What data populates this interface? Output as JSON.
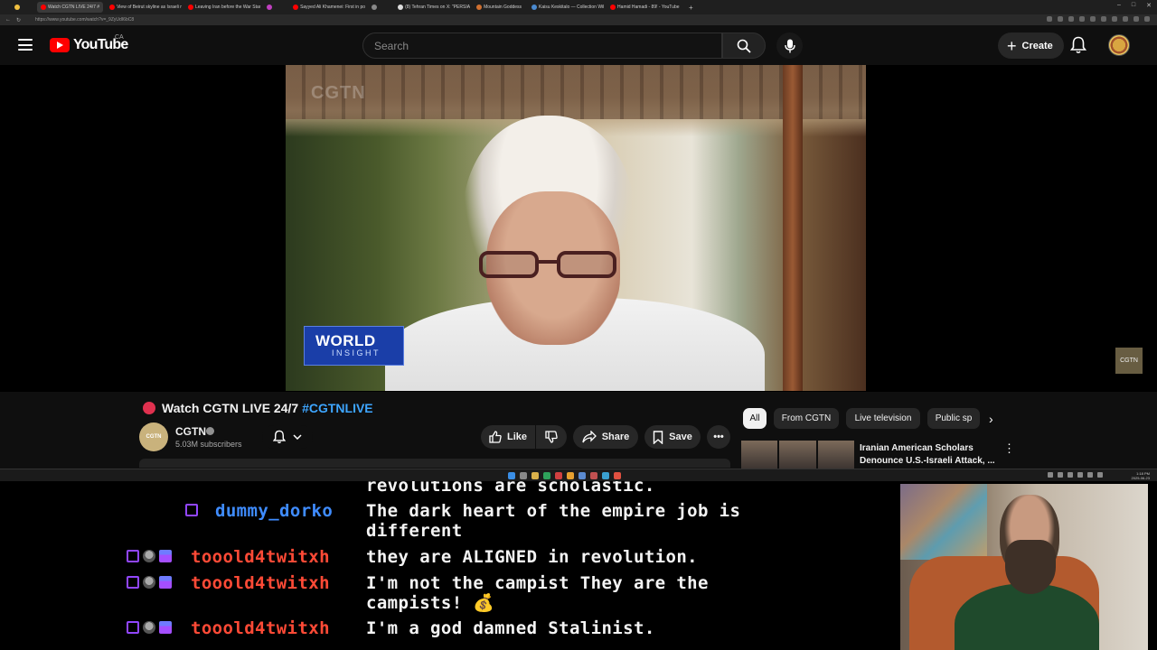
{
  "browser": {
    "tabs": [
      {
        "label": "",
        "color": "#f0c040"
      },
      {
        "label": "Watch CGTN LIVE 24/7 #",
        "color": "#ff0000",
        "active": true
      },
      {
        "label": "View of Beirut skyline as Israeli m",
        "color": "#ff0000"
      },
      {
        "label": "Leaving Iran before the War Starts",
        "color": "#ff0000"
      },
      {
        "label": "",
        "color": "#c040c0"
      },
      {
        "label": "Sayyed Ali Khamenei: First in pov",
        "color": "#ff0000"
      },
      {
        "label": "",
        "color": "#888888"
      },
      {
        "label": "(8) Tehran Times on X: \"PERSIAN",
        "color": "#dddddd"
      },
      {
        "label": "Mountain Goddess",
        "color": "#d07030"
      },
      {
        "label": "Kaisu Keskitalo — Collection Wiki",
        "color": "#4a8ad0"
      },
      {
        "label": "Hamid Hamadi - 89! - YouTube",
        "color": "#ff0000"
      }
    ],
    "new_tab": "+",
    "url": "https://www.youtube.com/watch?v=_9ZyUdI6bC8",
    "window_controls": [
      "–",
      "□",
      "✕"
    ]
  },
  "header": {
    "logo": "YouTube",
    "region": "CA",
    "search_placeholder": "Search",
    "create_label": "Create"
  },
  "video": {
    "watermark": "CGTN",
    "badge_top": "WORLD",
    "badge_bottom": "INSIGHT",
    "corner_logo": "CGTN"
  },
  "meta": {
    "title_prefix": "Watch CGTN LIVE 24/7 ",
    "title_tag": "#CGTNLIVE",
    "channel_name": "CGTN",
    "channel_avatar_text": "CGTN",
    "subscribers": "5.03M subscribers",
    "like_label": "Like",
    "share_label": "Share",
    "save_label": "Save"
  },
  "chips": [
    "All",
    "From CGTN",
    "Live television",
    "Public sp"
  ],
  "recommendation": {
    "title": "Iranian American Scholars Denounce U.S.-Israeli Attack, ..."
  },
  "chat": {
    "partial_line": "revolutions are scholastic.",
    "messages": [
      {
        "user": "dummy_dorko",
        "lines": [
          "The dark heart of the empire job is",
          "different"
        ]
      },
      {
        "user": "tooold4twitxh",
        "lines": [
          "they are ALIGNED in revolution."
        ]
      },
      {
        "user": "tooold4twitxh",
        "lines": [
          "I'm not the campist They are the",
          "campists! 💰"
        ]
      },
      {
        "user": "tooold4twitxh",
        "lines": [
          "I'm a god damned Stalinist."
        ]
      }
    ]
  },
  "taskbar": {
    "clock_time": "1:18 PM",
    "clock_date": "2025-06-23"
  },
  "colors": {
    "accent_red": "#ff0000",
    "live_dot": "#e0314f",
    "hashtag": "#3ea6ff",
    "user_blue": "#3f8cff",
    "user_red": "#ff4a36"
  }
}
